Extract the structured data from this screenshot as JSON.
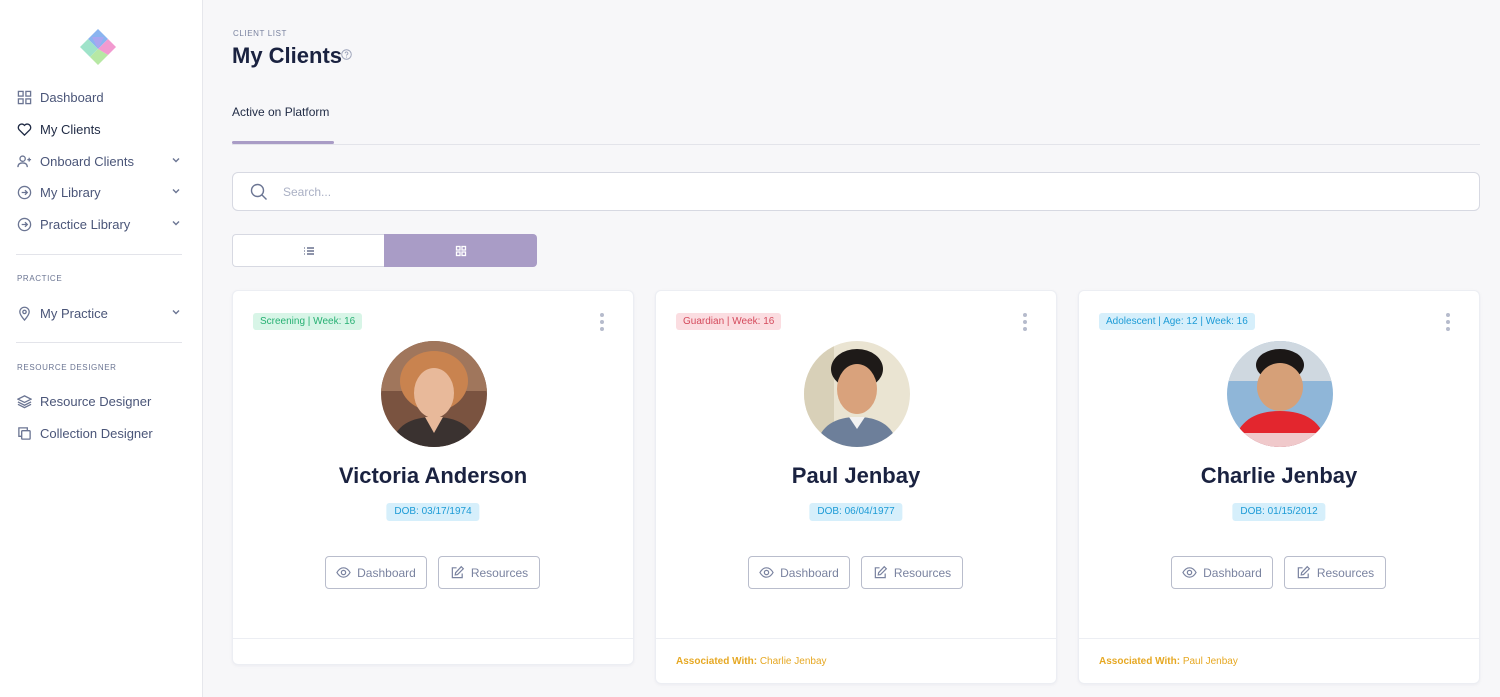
{
  "sidebar": {
    "nav": [
      {
        "label": "Dashboard",
        "icon": "grid-icon",
        "active": false
      },
      {
        "label": "My Clients",
        "icon": "heart-icon",
        "active": true
      },
      {
        "label": "Onboard Clients",
        "icon": "user-plus-icon",
        "expandable": true
      },
      {
        "label": "My Library",
        "icon": "arrow-circle-icon",
        "expandable": true
      },
      {
        "label": "Practice Library",
        "icon": "arrow-circle-icon",
        "expandable": true
      }
    ],
    "practice_section": "PRACTICE",
    "practice_nav": [
      {
        "label": "My Practice",
        "icon": "map-pin-icon",
        "expandable": true
      }
    ],
    "resource_section": "RESOURCE DESIGNER",
    "resource_nav": [
      {
        "label": "Resource Designer",
        "icon": "layers-icon"
      },
      {
        "label": "Collection Designer",
        "icon": "copy-icon"
      }
    ]
  },
  "header": {
    "breadcrumb": "CLIENT LIST",
    "title": "My Clients"
  },
  "tabs": [
    {
      "label": "Active on Platform",
      "active": true
    }
  ],
  "search": {
    "placeholder": "Search...",
    "value": ""
  },
  "view_toggle": {
    "selected": "grid"
  },
  "colors": {
    "accent": "#a99cc6",
    "assoc": "#e6a823"
  },
  "clients": [
    {
      "tag": "Screening  | Week: 16",
      "tag_color": "green",
      "name": "Victoria Anderson",
      "dob": "DOB: 03/17/1974",
      "dashboard_label": "Dashboard",
      "resources_label": "Resources",
      "associated_label": "",
      "associated_name": ""
    },
    {
      "tag": "Guardian  | Week: 16",
      "tag_color": "red",
      "name": "Paul Jenbay",
      "dob": "DOB: 06/04/1977",
      "dashboard_label": "Dashboard",
      "resources_label": "Resources",
      "associated_label": "Associated With:",
      "associated_name": "Charlie Jenbay"
    },
    {
      "tag": "Adolescent  | Age: 12 | Week: 16",
      "tag_color": "blue",
      "name": "Charlie Jenbay",
      "dob": "DOB: 01/15/2012",
      "dashboard_label": "Dashboard",
      "resources_label": "Resources",
      "associated_label": "Associated With:",
      "associated_name": "Paul Jenbay"
    }
  ]
}
